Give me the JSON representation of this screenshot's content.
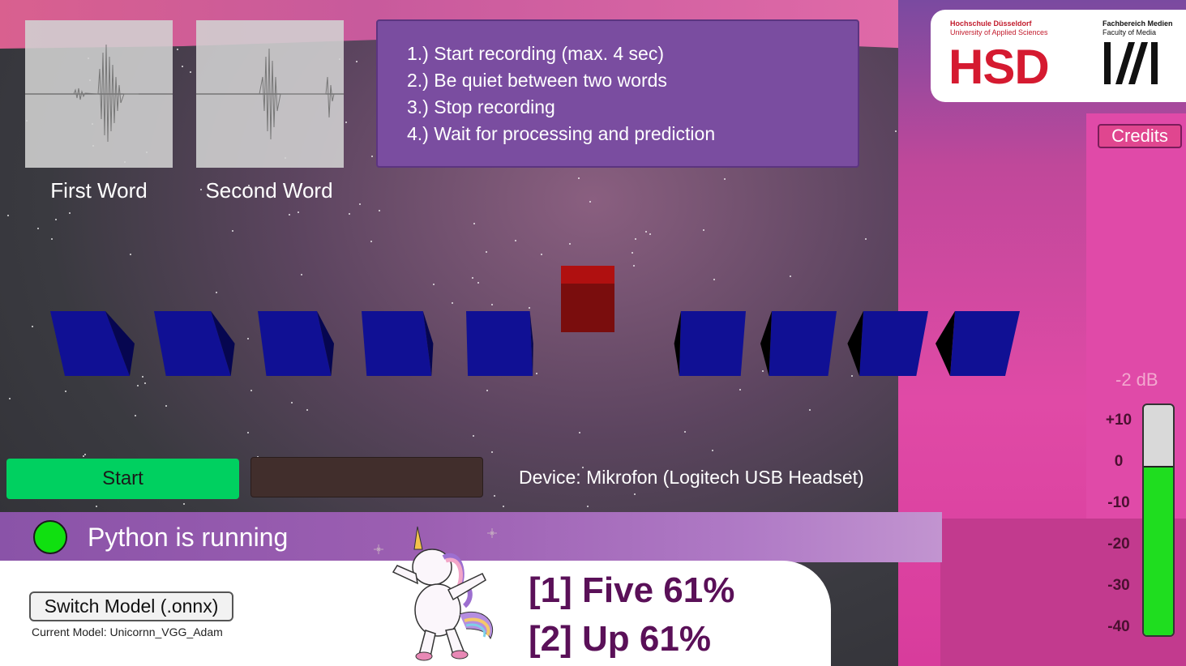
{
  "waveforms": [
    {
      "label": "First Word"
    },
    {
      "label": "Second Word"
    }
  ],
  "instructions": [
    "1.) Start recording (max. 4 sec)",
    "2.) Be quiet between two words",
    "3.) Stop recording",
    "4.) Wait for processing and prediction"
  ],
  "logo": {
    "hsd_line1": "Hochschule Düsseldorf",
    "hsd_line2": "University of Applied Sciences",
    "hsd_mark": "HSD",
    "fm_line1": "Fachbereich Medien",
    "fm_line2": "Faculty of Media"
  },
  "credits_label": "Credits",
  "meter": {
    "db_readout": "-2 dB",
    "scale": [
      "+10",
      "0",
      "-10",
      "-20",
      "-30",
      "-40"
    ],
    "level_fraction": 0.73,
    "fill_color": "#1fdd1f"
  },
  "cubes": {
    "active_index": 5,
    "active_color": "#b01010",
    "inactive_color": "#0d0d80",
    "count": 10
  },
  "controls": {
    "start_label": "Start",
    "device_text": "Device: Mikrofon (Logitech USB Headset)"
  },
  "status": {
    "text": "Python is running",
    "color": "#10e010"
  },
  "model": {
    "switch_label": "Switch Model (.onnx)",
    "current_text": "Current Model: Unicornn_VGG_Adam"
  },
  "predictions": [
    "[1] Five 61%",
    "[2] Up 61%"
  ]
}
